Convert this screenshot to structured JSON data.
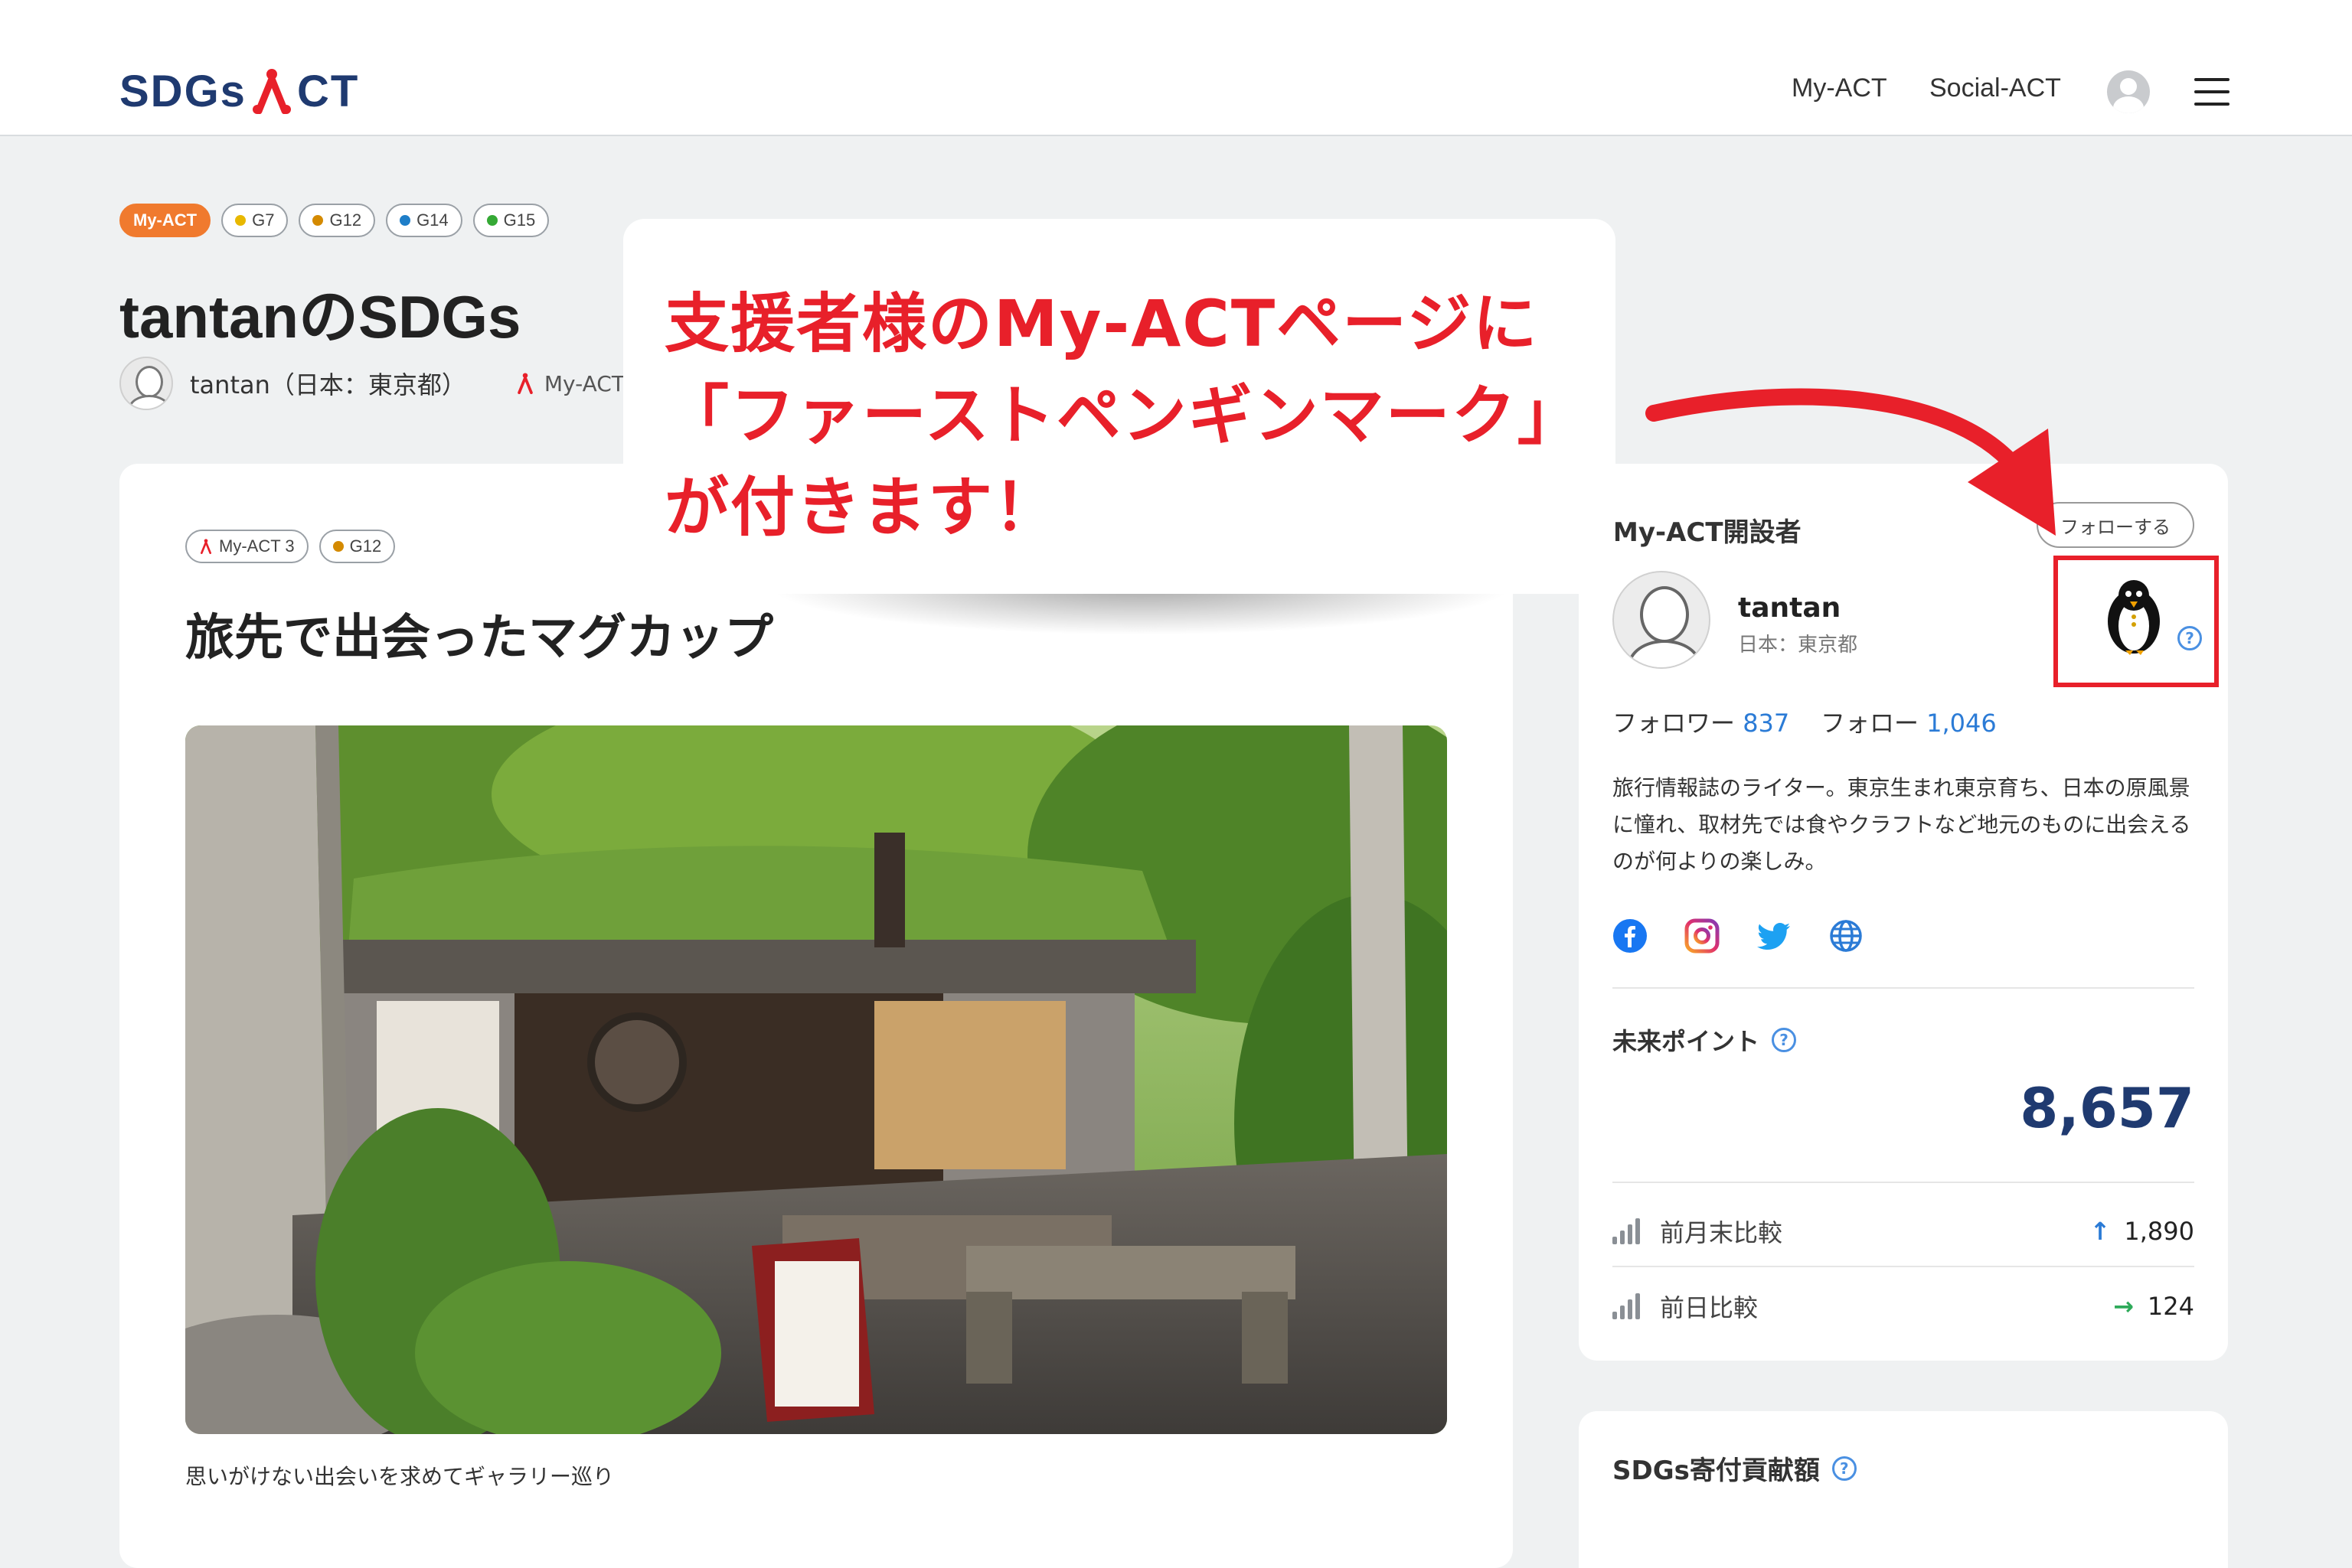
{
  "header": {
    "logo_left": "SDGs",
    "logo_right": "CT",
    "nav": [
      "My-ACT",
      "Social-ACT"
    ]
  },
  "page": {
    "tags": [
      {
        "label": "My-ACT",
        "style": "orange"
      },
      {
        "label": "G7",
        "dot": "#e8b800"
      },
      {
        "label": "G12",
        "dot": "#d48a00"
      },
      {
        "label": "G14",
        "dot": "#1e7ec8"
      },
      {
        "label": "G15",
        "dot": "#35a935"
      }
    ],
    "title": "tantanのSDGs",
    "author": "tantan（日本：東京都）",
    "author_act": "My-ACT"
  },
  "article": {
    "tags": [
      {
        "label": "My-ACT 3"
      },
      {
        "label": "G12",
        "dot": "#d48a00"
      }
    ],
    "title": "旅先で出会ったマグカップ",
    "caption": "思いがけない出会いを求めてギャラリー巡り"
  },
  "sidebar": {
    "heading": "My-ACT開設者",
    "follow_button": "フォローする",
    "name": "tantan",
    "location": "日本：東京都",
    "followers_label": "フォロワー",
    "followers": "837",
    "following_label": "フォロー",
    "following": "1,046",
    "bio": "旅行情報誌のライター。東京生まれ東京育ち、日本の原風景に憧れ、取材先では食やクラフトなど地元のものに出会えるのが何よりの楽しみ。",
    "points_title": "未来ポイント",
    "points": "8,657",
    "stats": [
      {
        "label": "前月末比較",
        "value": "1,890",
        "arrow": "↑"
      },
      {
        "label": "前日比較",
        "value": "124",
        "arrow": "→"
      }
    ],
    "donation_title": "SDGs寄付貢献額"
  },
  "annotation": {
    "lines": [
      "支援者様のMy-ACTページに",
      "「ファーストペンギンマーク」",
      "が付きます！"
    ],
    "color": "#e8202a"
  },
  "colors": {
    "brand": "#1f3a70",
    "accent": "#f07a2e",
    "link": "#2b7bd6",
    "highlight": "#e8202a"
  }
}
